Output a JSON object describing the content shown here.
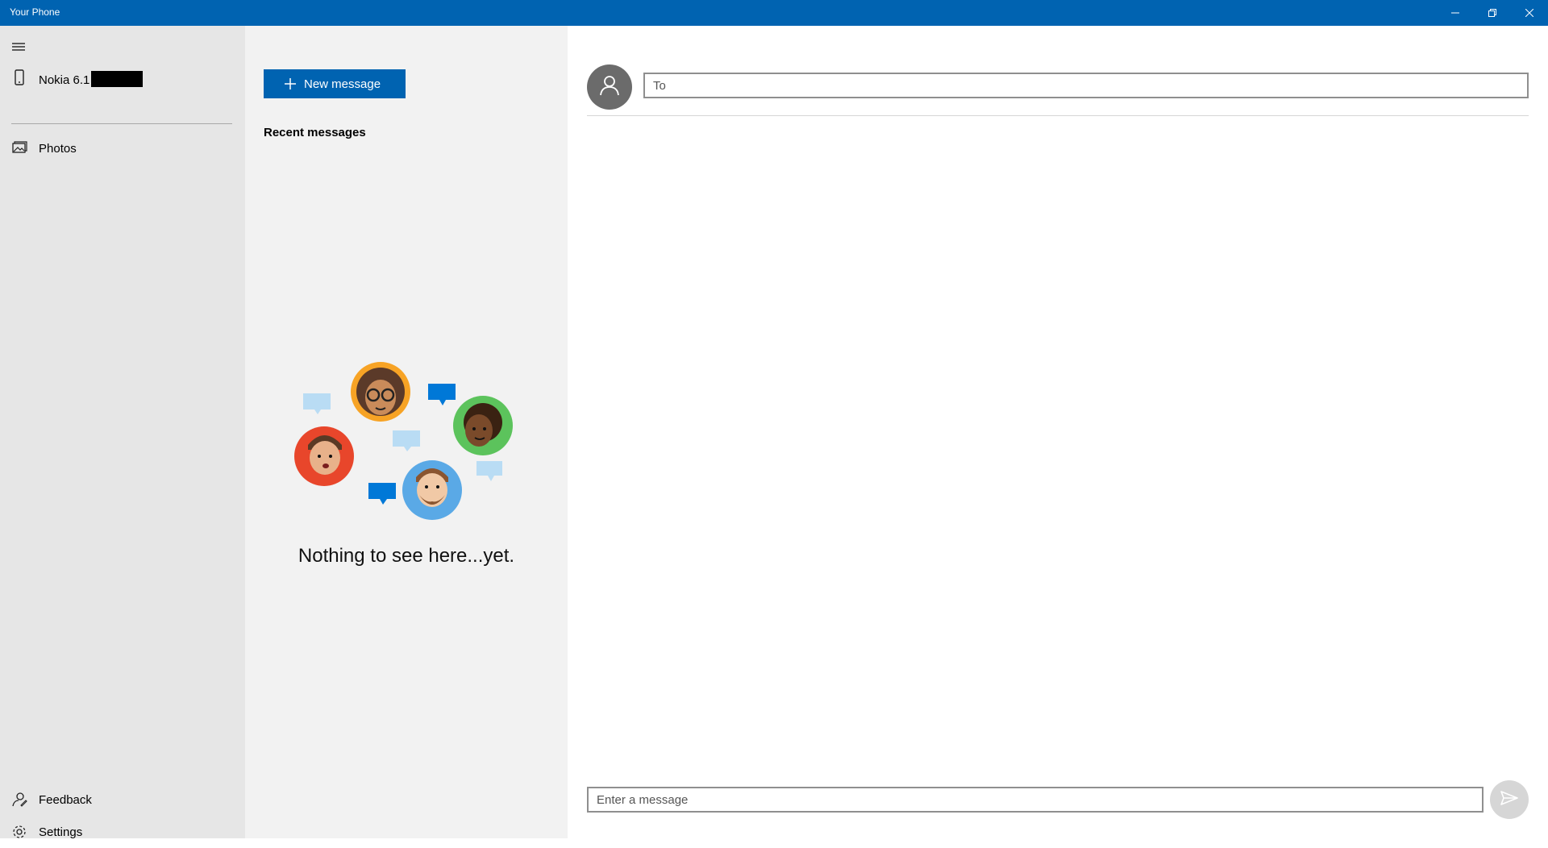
{
  "window": {
    "title": "Your Phone",
    "controls": {
      "minimize": "minimize-icon",
      "restore": "restore-icon",
      "close": "close-icon"
    },
    "accent": "#0063b1"
  },
  "sidebar": {
    "menu_icon": "hamburger-icon",
    "device": {
      "label": "Nokia 6.1",
      "icon": "phone-icon",
      "redacted": true
    },
    "items": [
      {
        "label": "Photos",
        "icon": "photos-icon"
      }
    ],
    "footer": [
      {
        "label": "Feedback",
        "icon": "feedback-icon"
      },
      {
        "label": "Settings",
        "icon": "gear-icon"
      }
    ],
    "background": "#e6e6e6"
  },
  "messages_pane": {
    "new_message_label": "New message",
    "recent_heading": "Recent messages",
    "empty_text": "Nothing to see here...yet.",
    "background": "#f2f2f2"
  },
  "compose": {
    "to_placeholder": "To",
    "message_placeholder": "Enter a message",
    "send_icon": "send-icon"
  }
}
